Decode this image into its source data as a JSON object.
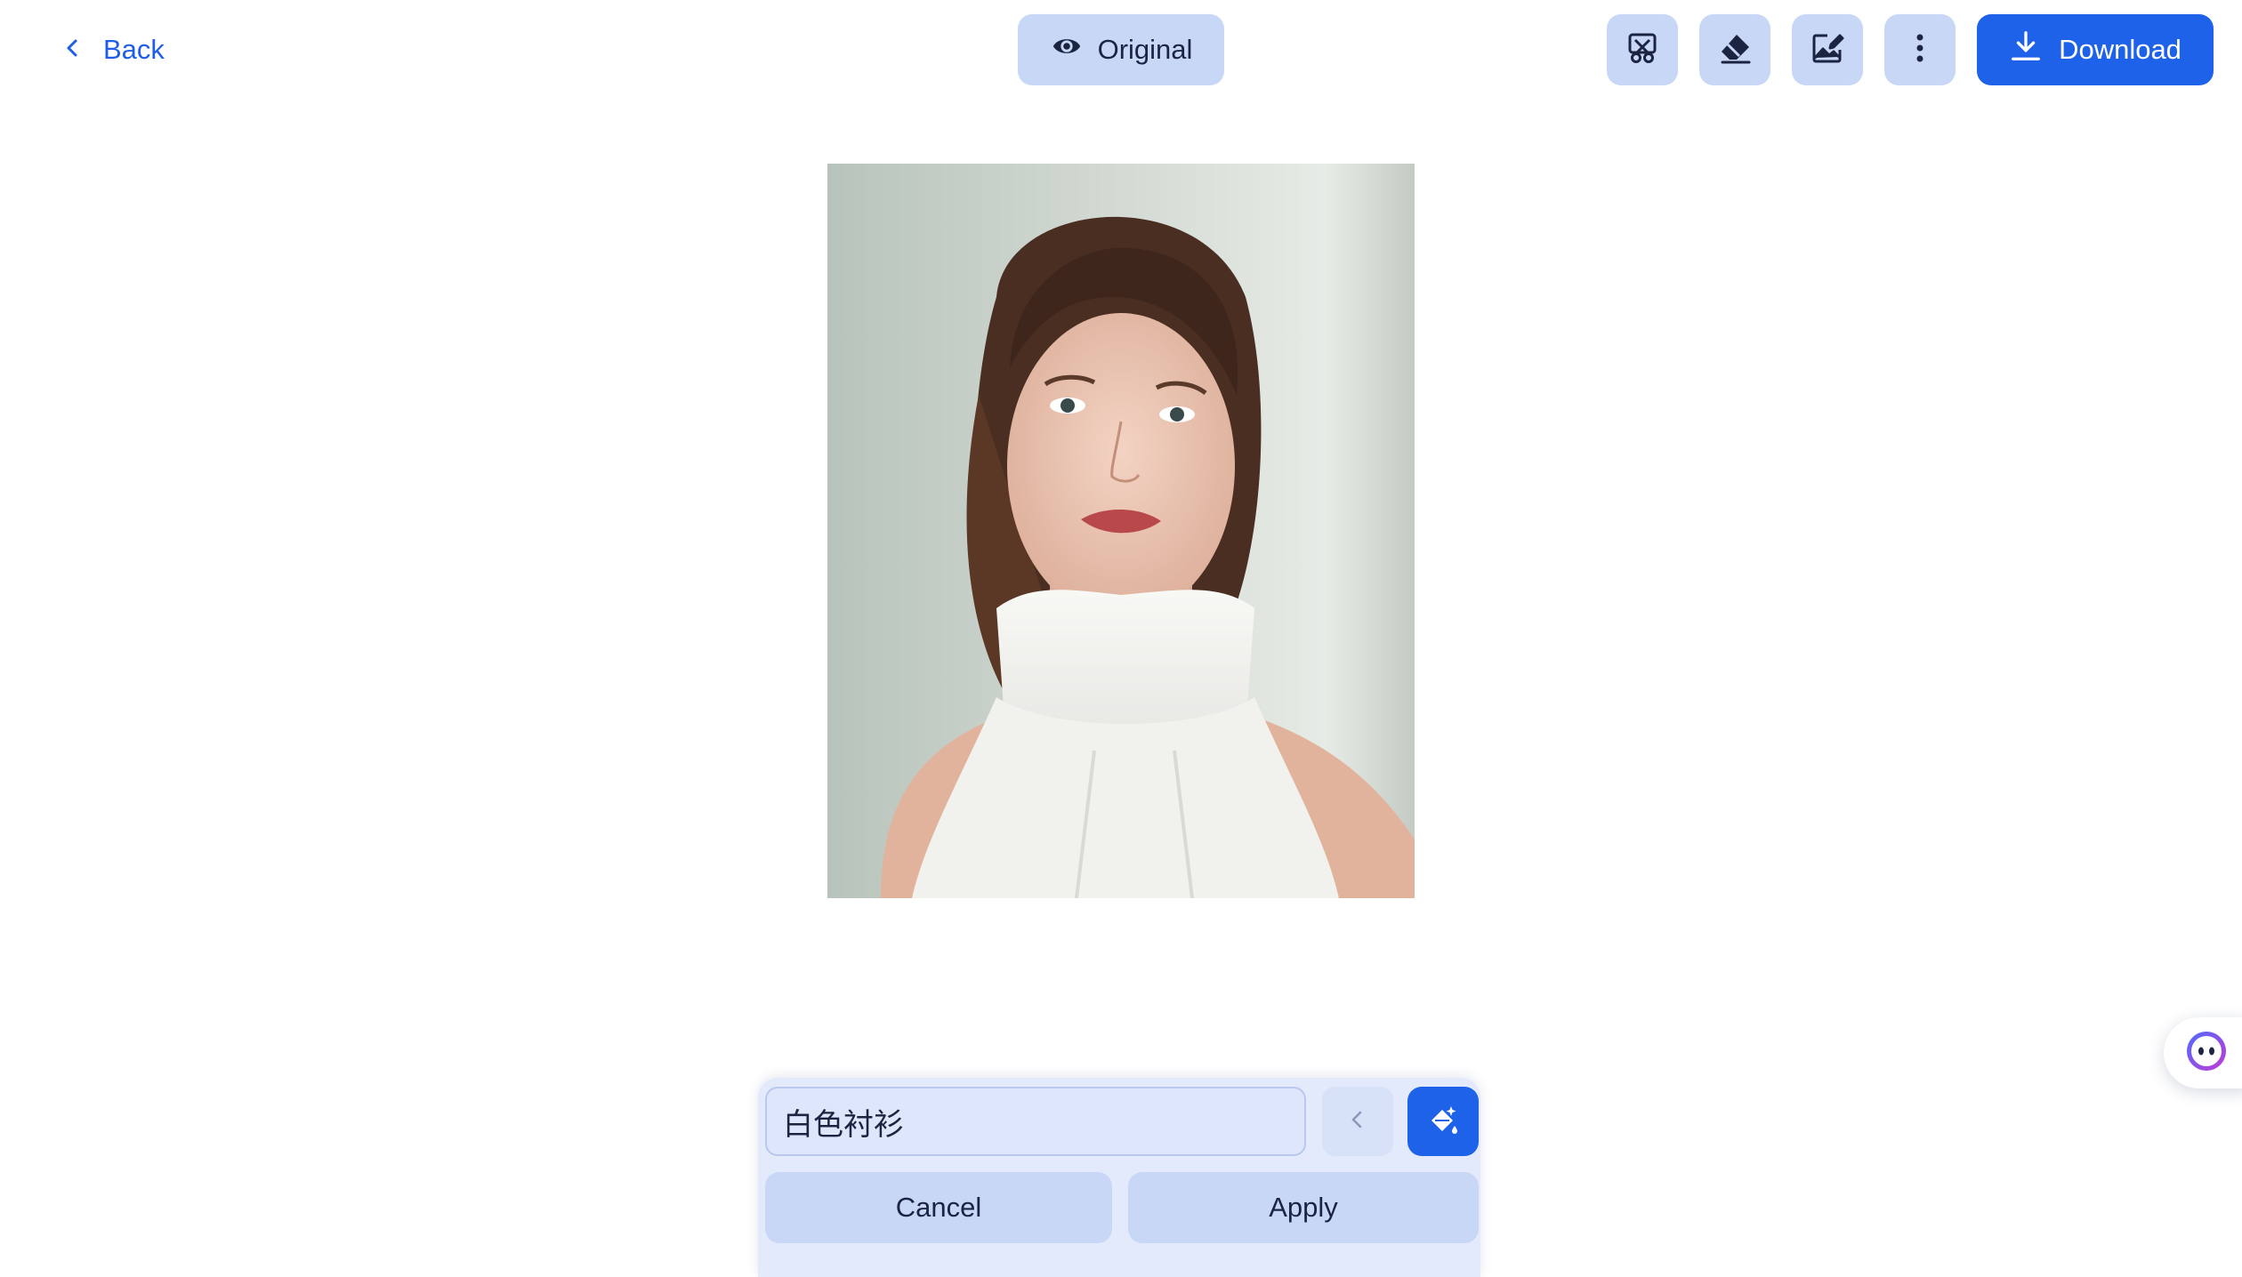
{
  "header": {
    "back_label": "Back",
    "original_label": "Original",
    "download_label": "Download",
    "tools": [
      {
        "icon": "cutout-scissors-icon"
      },
      {
        "icon": "eraser-icon"
      },
      {
        "icon": "image-edit-icon"
      },
      {
        "icon": "more-vertical-icon"
      }
    ]
  },
  "canvas": {
    "image_alt": "Portrait photo"
  },
  "prompt_panel": {
    "input_value": "白色衬衫",
    "cancel_label": "Cancel",
    "apply_label": "Apply"
  },
  "colors": {
    "accent": "#1f62ea",
    "button_bg": "#c9d7f6",
    "panel_bg": "#e3eafb"
  }
}
